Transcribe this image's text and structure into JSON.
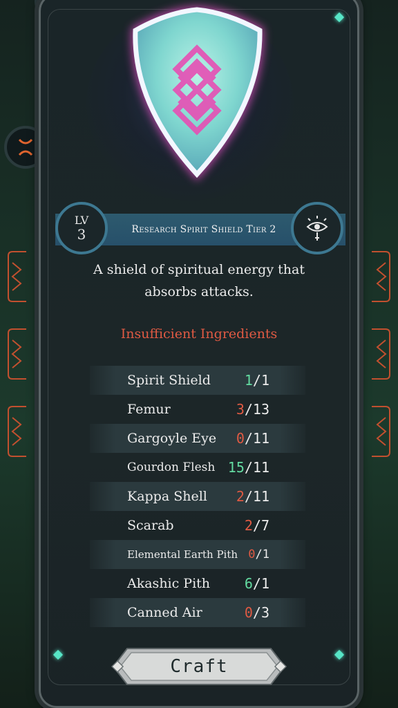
{
  "recipe": {
    "level_label": "LV",
    "level": "3",
    "title": "Research Spirit Shield Tier 2",
    "description": "A shield of spiritual energy that absorbs attacks.",
    "status": "Insufficient Ingredients",
    "ingredients": [
      {
        "name": "Spirit Shield",
        "have": "1",
        "need": "/1",
        "sufficient": true
      },
      {
        "name": "Femur",
        "have": "3",
        "need": "/13",
        "sufficient": false
      },
      {
        "name": "Gargoyle Eye",
        "have": "0",
        "need": "/11",
        "sufficient": false
      },
      {
        "name": "Gourdon Flesh",
        "have": "15",
        "need": "/11",
        "sufficient": true
      },
      {
        "name": "Kappa Shell",
        "have": "2",
        "need": "/11",
        "sufficient": false
      },
      {
        "name": "Scarab",
        "have": "2",
        "need": "/7",
        "sufficient": false
      },
      {
        "name": "Elemental Earth Pith",
        "have": "0",
        "need": "/1",
        "sufficient": false
      },
      {
        "name": "Akashic Pith",
        "have": "6",
        "need": "/1",
        "sufficient": true
      },
      {
        "name": "Canned Air",
        "have": "0",
        "need": "/3",
        "sufficient": false
      }
    ],
    "craft_label": "Craft"
  },
  "icons": {
    "item": "spirit-shield-icon",
    "category": "eye-icon"
  },
  "colors": {
    "sufficient": "#63dba1",
    "insufficient": "#e05a43",
    "accent_gem": "#57e5c6",
    "banner": "#2d5a6e"
  }
}
